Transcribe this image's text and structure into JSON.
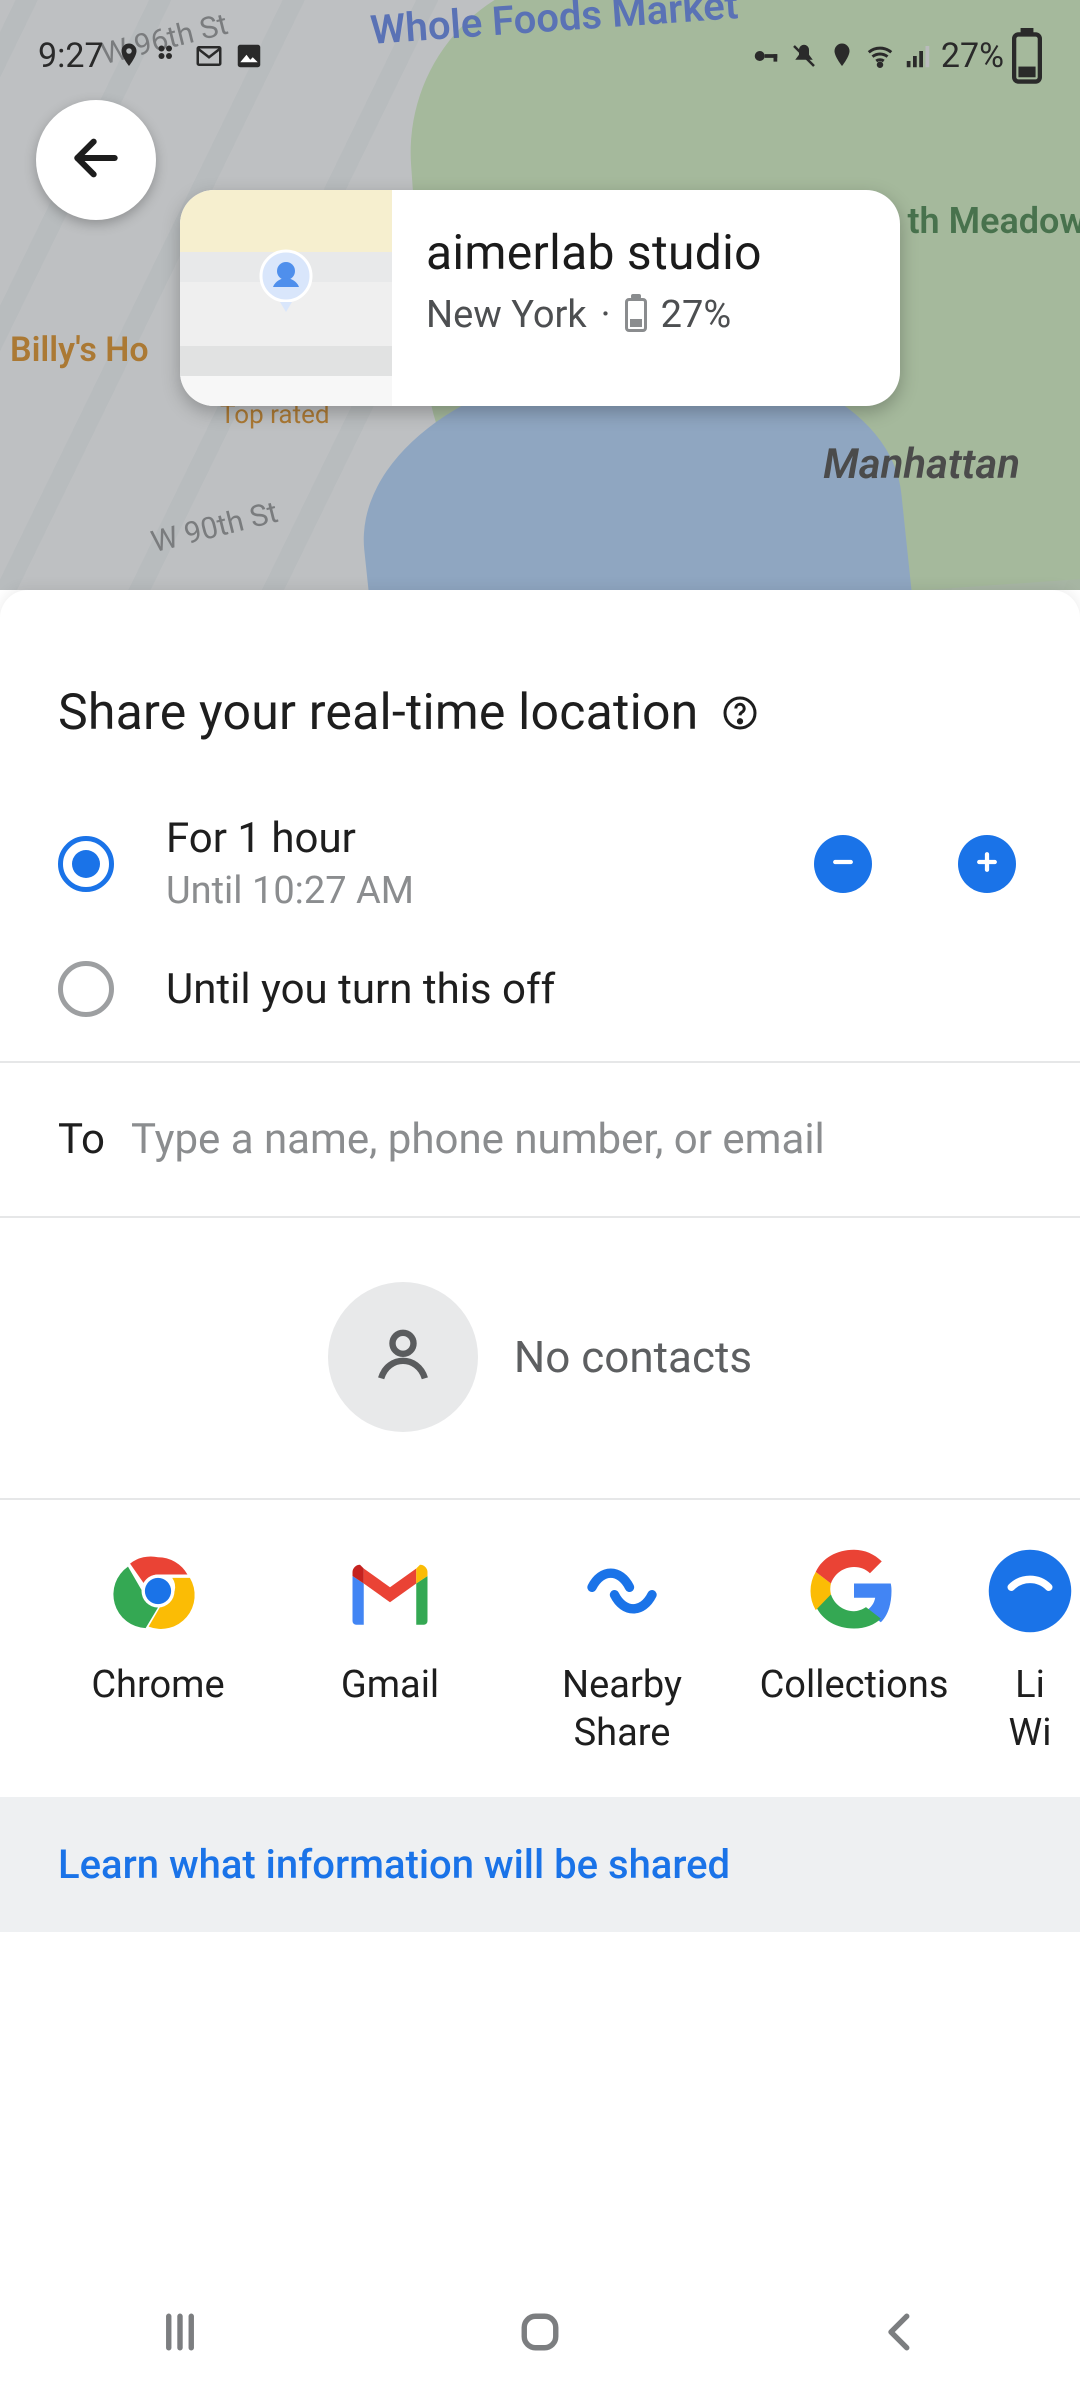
{
  "status_bar": {
    "time": "9:27",
    "battery_text": "27%"
  },
  "map": {
    "labels": {
      "whole_foods": "Whole Foods Market",
      "w96": "W 96th St",
      "w90": "W 90th St",
      "billy": "Billy's Ho",
      "top_rated": "Top rated",
      "north_meadow": "th Meadow",
      "manhattan": "Manhattan"
    },
    "location_card": {
      "title": "aimerlab studio",
      "subtitle_city": "New York",
      "subtitle_dot": "·",
      "subtitle_battery": "27%"
    }
  },
  "sheet": {
    "title": "Share your real-time location",
    "options": {
      "for_duration": {
        "primary": "For 1 hour",
        "secondary": "Until 10:27 AM",
        "selected": true
      },
      "until_off": {
        "primary": "Until you turn this off",
        "selected": false
      }
    },
    "to_label": "To",
    "to_placeholder": "Type a name, phone number, or email",
    "no_contacts": "No contacts",
    "apps": [
      {
        "id": "chrome",
        "label": "Chrome"
      },
      {
        "id": "gmail",
        "label": "Gmail"
      },
      {
        "id": "nearby",
        "label": "Nearby Share"
      },
      {
        "id": "collections",
        "label": "Collections"
      },
      {
        "id": "linkwifi",
        "label": "Li\nWi"
      }
    ],
    "learn_link": "Learn what information will be shared"
  },
  "colors": {
    "primary": "#1a73e8"
  }
}
